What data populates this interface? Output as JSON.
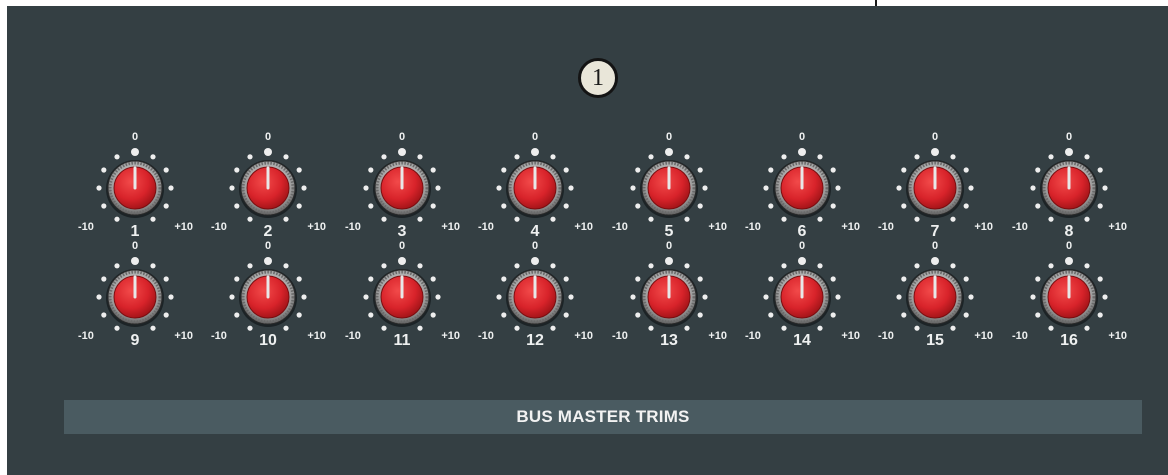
{
  "panel": {
    "badge": "1",
    "title": "BUS MASTER TRIMS"
  },
  "scale": {
    "zero": "0",
    "min": "-10",
    "max": "+10"
  },
  "trims": [
    {
      "label": "1",
      "value": 0
    },
    {
      "label": "2",
      "value": 0
    },
    {
      "label": "3",
      "value": 0
    },
    {
      "label": "4",
      "value": 0
    },
    {
      "label": "5",
      "value": 0
    },
    {
      "label": "6",
      "value": 0
    },
    {
      "label": "7",
      "value": 0
    },
    {
      "label": "8",
      "value": 0
    },
    {
      "label": "9",
      "value": 0
    },
    {
      "label": "10",
      "value": 0
    },
    {
      "label": "11",
      "value": 0
    },
    {
      "label": "12",
      "value": 0
    },
    {
      "label": "13",
      "value": 0
    },
    {
      "label": "14",
      "value": 0
    },
    {
      "label": "15",
      "value": 0
    },
    {
      "label": "16",
      "value": 0
    }
  ],
  "colors": {
    "panel": "#343f43",
    "knob_cap": "#d8232a",
    "title_bar": "#4a5b61"
  }
}
